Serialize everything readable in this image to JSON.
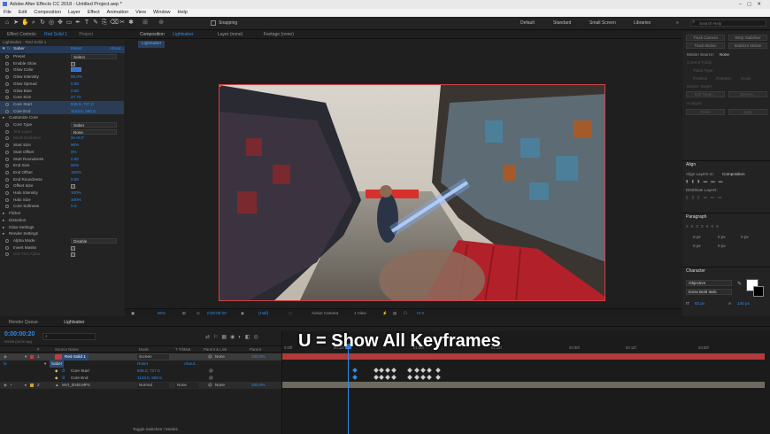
{
  "title": "Adobe After Effects CC 2018 - Untitled Project.aep *",
  "menu": [
    "File",
    "Edit",
    "Composition",
    "Layer",
    "Effect",
    "Animation",
    "View",
    "Window",
    "Help"
  ],
  "toolbar": {
    "snapping": "Snapping",
    "workspaces": [
      "Default",
      "Standard",
      "Small Screen",
      "Libraries"
    ],
    "search_placeholder": "Search Help"
  },
  "effects_panel": {
    "tab": "Effect Controls",
    "layer_name": "Red Solid 1",
    "project_tab": "Project",
    "breadcrumb": "Lightsaber · Red Solid 1"
  },
  "effect": {
    "name": "Saber",
    "reset": "Reset",
    "about": "About..."
  },
  "rows": [
    {
      "label": "Preset",
      "value": "Select",
      "type": "drop"
    },
    {
      "label": "Enable Glow",
      "type": "check"
    },
    {
      "label": "Glow Color",
      "type": "color"
    },
    {
      "label": "Glow Intensity",
      "value": "50.0%"
    },
    {
      "label": "Glow Spread",
      "value": "0.60"
    },
    {
      "label": "Glow Bias",
      "value": "0.50"
    },
    {
      "label": "Core Size",
      "value": "27.70"
    },
    {
      "label": "Core Start",
      "value": "845.0, 727.0",
      "hl": true
    },
    {
      "label": "Core End",
      "value": "1143.5, 550.5",
      "hl": true
    },
    {
      "label": "Customize Core",
      "type": "group"
    },
    {
      "label": "Core Type",
      "value": "Saber",
      "type": "drop"
    },
    {
      "label": "Text Layer",
      "value": "None",
      "type": "drop",
      "dim": true
    },
    {
      "label": "Mask Evolution",
      "value": "0x+0.0°",
      "dim": true
    },
    {
      "label": "Start Size",
      "value": "90%"
    },
    {
      "label": "Start Offset",
      "value": "0%"
    },
    {
      "label": "Start Roundness",
      "value": "0.50"
    },
    {
      "label": "End Size",
      "value": "50%"
    },
    {
      "label": "End Offset",
      "value": "100%"
    },
    {
      "label": "End Roundness",
      "value": "0.00"
    },
    {
      "label": "Offset Size",
      "type": "check"
    },
    {
      "label": "Halo Intensity",
      "value": "100%"
    },
    {
      "label": "Halo Size",
      "value": "100%"
    },
    {
      "label": "Core Softness",
      "value": "0.0"
    },
    {
      "label": "Flicker",
      "type": "group"
    },
    {
      "label": "Distortion",
      "type": "group"
    },
    {
      "label": "Glow Settings",
      "type": "group"
    },
    {
      "label": "Render Settings",
      "type": "group"
    },
    {
      "label": "Alpha Mode",
      "value": "Disable",
      "type": "drop"
    },
    {
      "label": "Invert Masks",
      "type": "check"
    },
    {
      "label": "Use Text Alpha",
      "type": "check",
      "dim": true
    }
  ],
  "comp_panel": {
    "tab": "Composition",
    "comp_name": "Lightsaber",
    "layer_tab": "Layer (none)",
    "footage_tab": "Footage (none)",
    "chip": "Lightsaber"
  },
  "viewer_bar": {
    "zoom": "50%",
    "timecode": "0:00:00:20",
    "quality": "(Half)",
    "camera": "Active Camera",
    "views": "1 View",
    "exposure": "+0.0"
  },
  "right": {
    "tracker_buttons": [
      "Track Camera",
      "Warp Stabilizer",
      "Track Motion",
      "Stabilize Motion"
    ],
    "motion_source_label": "Motion Source:",
    "motion_source": "None",
    "current_track": "Current Track:",
    "track_type": "Track Type:",
    "position": "Position",
    "rotation": "Rotation",
    "scale": "Scale",
    "motion_target": "Motion Target:",
    "edit_target": "Edit Target...",
    "options": "Options...",
    "analyze": "Analyze:",
    "reset": "Reset",
    "apply": "Apply",
    "align": {
      "title": "Align",
      "align_to": "Align Layers to:",
      "target": "Composition",
      "distribute": "Distribute Layers:"
    },
    "paragraph": {
      "title": "Paragraph",
      "v1": "0 px",
      "v2": "0 px",
      "v3": "0 px",
      "v4": "0 px",
      "v5": "0 px"
    },
    "character": {
      "title": "Character",
      "font": "Objective",
      "style": "Extra Bold Italic",
      "size": "82 px",
      "leading": "140 px"
    }
  },
  "timeline": {
    "render_queue": "Render Queue",
    "comp_tab": "Lightsaber",
    "timecode": "0:00:00:20",
    "fps": "00020 (24.00 fps)",
    "cols": [
      "#",
      "Source Name",
      "Mode",
      "T TrkMat",
      "Parent & Link",
      "Parent"
    ],
    "layers": [
      {
        "num": "1",
        "name": "Red Solid 1",
        "mode": "Screen",
        "parent": "None",
        "color": "#c53b3b",
        "pct": "100.0%"
      },
      {
        "num": "",
        "name": "Saber",
        "reset": "Reset",
        "about": "About..."
      },
      {
        "num": "",
        "name": "Core Start",
        "value": "845.0, 727.0"
      },
      {
        "num": "",
        "name": "Core End",
        "value": "1143.5, 550.5"
      },
      {
        "num": "2",
        "name": "MVI_0046.MP4",
        "mode": "Normal",
        "trkmat": "None",
        "parent": "None",
        "color": "#c8a23b",
        "pct": "100.0%"
      }
    ],
    "ruler": [
      "0:00f",
      "00:12f",
      "01:00f",
      "01:12f",
      "02:00f",
      "02:12f",
      "03:00f"
    ],
    "overlay": "U = Show All Keyframes",
    "toggle": "Toggle Switches / Modes"
  }
}
